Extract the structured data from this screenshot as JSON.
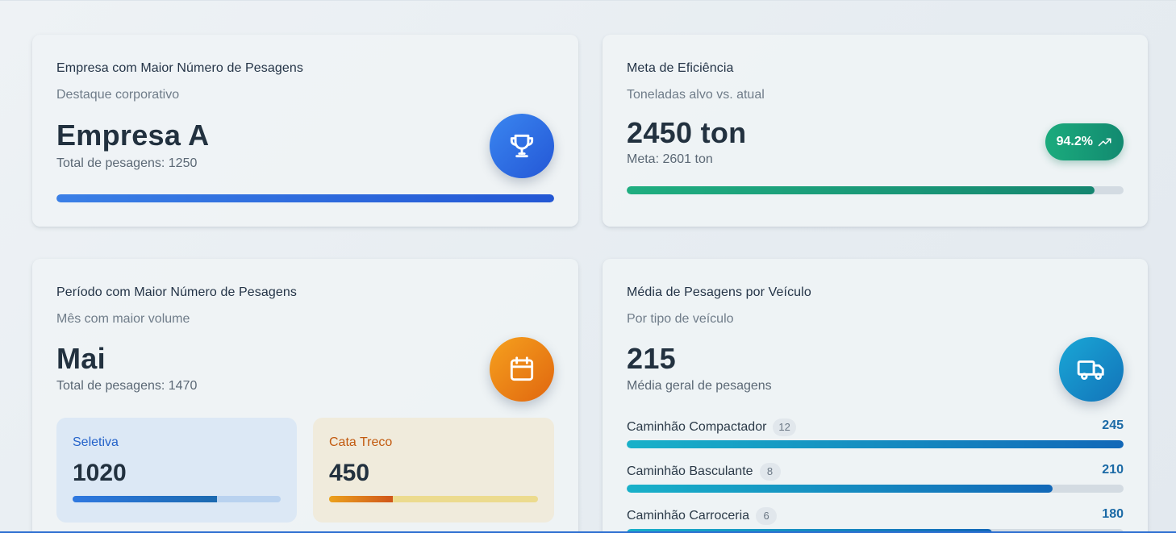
{
  "card_top_company": {
    "title": "Empresa com Maior Número de Pesagens",
    "subtitle": "Destaque corporativo",
    "value": "Empresa A",
    "caption": "Total de pesagens: 1250",
    "progress": 1.0,
    "icon": "trophy-icon",
    "accent_color": "#2f6fe0"
  },
  "card_efficiency": {
    "title": "Meta de Eficiência",
    "subtitle": "Toneladas alvo vs. atual",
    "value": "2450 ton",
    "caption": "Meta: 2601 ton",
    "badge": "94.2%",
    "badge_icon": "trending-up-icon",
    "progress": 0.942,
    "accent_color": "#16a17b"
  },
  "card_top_period": {
    "title": "Período com Maior Número de Pesagens",
    "subtitle": "Mês com maior volume",
    "value": "Mai",
    "caption": "Total de pesagens: 1470",
    "icon": "calendar-icon",
    "accent_color": "#ea7a12",
    "breakdown": [
      {
        "label": "Seletiva",
        "value": "1020",
        "progress": 0.694,
        "color": "#2563c9"
      },
      {
        "label": "Cata Treco",
        "value": "450",
        "progress": 0.306,
        "color": "#c25a0f"
      }
    ]
  },
  "card_vehicle_avg": {
    "title": "Média de Pesagens por Veículo",
    "subtitle": "Por tipo de veículo",
    "value": "215",
    "caption": "Média geral de pesagens",
    "icon": "truck-icon",
    "accent_color": "#1386c9",
    "vehicles": [
      {
        "name": "Caminhão Compactador",
        "count": "12",
        "value": "245",
        "progress": 1.0
      },
      {
        "name": "Caminhão Basculante",
        "count": "8",
        "value": "210",
        "progress": 0.857
      },
      {
        "name": "Caminhão Carroceria",
        "count": "6",
        "value": "180",
        "progress": 0.735
      }
    ]
  }
}
